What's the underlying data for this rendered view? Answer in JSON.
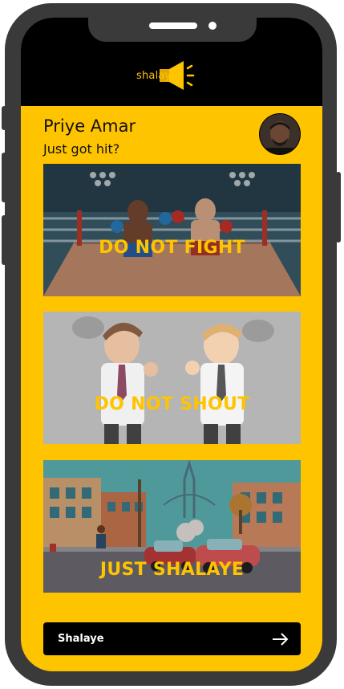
{
  "app": {
    "logo_text": "shalaye",
    "brand_color": "#ffc400"
  },
  "user": {
    "name": "Priye Amar",
    "status": "Just got hit?",
    "avatar_icon": "user-avatar"
  },
  "options": [
    {
      "label": "DO NOT FIGHT",
      "illustration": "boxing-ring-illustration"
    },
    {
      "label": "DO NOT SHOUT",
      "illustration": "shouting-men-illustration"
    },
    {
      "label": "JUST SHALAYE",
      "illustration": "car-crash-street-illustration"
    }
  ],
  "cta": {
    "label": "Shalaye",
    "icon": "arrow-right-icon"
  }
}
